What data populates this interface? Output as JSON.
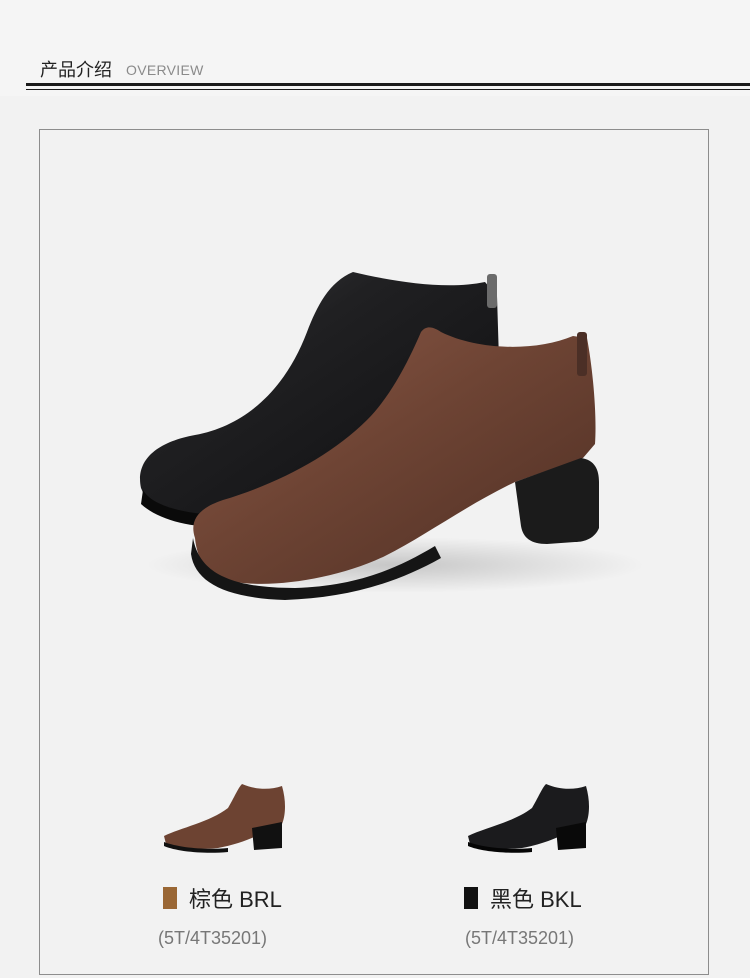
{
  "header": {
    "title": "产品介绍",
    "subtitle": "OVERVIEW"
  },
  "colors": {
    "brown_swatch": "#9a6735",
    "black_swatch": "#111111",
    "brown_shoe": "#6d4332",
    "black_shoe": "#1d1d1f"
  },
  "variants": [
    {
      "label": "棕色 BRL",
      "code": "(5T/4T35201)"
    },
    {
      "label": "黑色 BKL",
      "code": "(5T/4T35201)"
    }
  ]
}
